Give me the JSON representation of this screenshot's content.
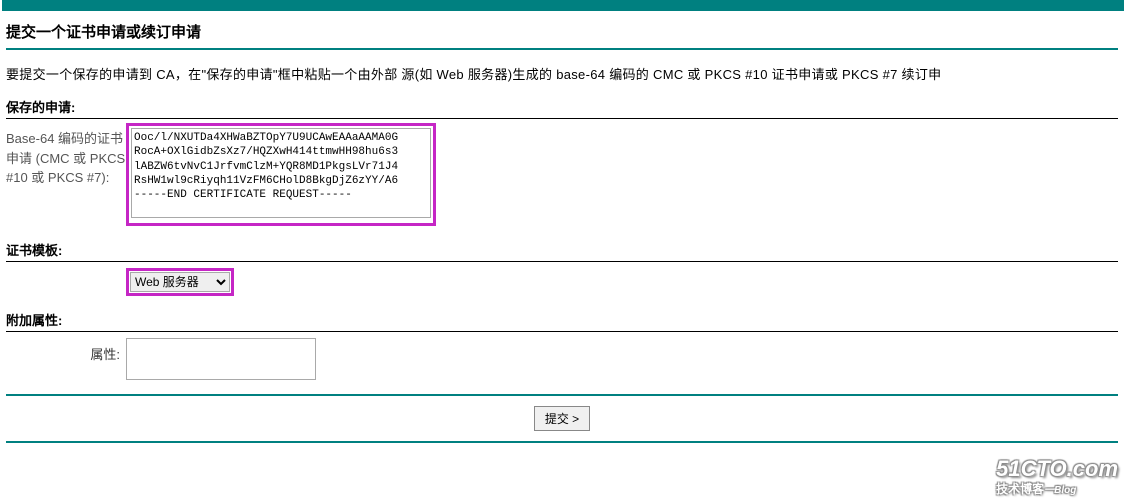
{
  "page": {
    "title": "提交一个证书申请或续订申请",
    "instructions": "要提交一个保存的申请到 CA，在\"保存的申请\"框中粘贴一个由外部 源(如 Web 服务器)生成的 base-64 编码的 CMC 或 PKCS #10 证书申请或 PKCS #7 续订申"
  },
  "saved_request": {
    "section_label": "保存的申请:",
    "field_label": "Base-64 编码的证书申请 (CMC 或 PKCS #10 或 PKCS #7):",
    "value": "Ooc/l/NXUTDa4XHWaBZTOpY7U9UCAwEAAaAAMA0G\nRocA+OXlGidbZsXz7/HQZXwH414ttmwHH98hu6s3\nlABZW6tvNvC1JrfvmClzM+YQR8MD1PkgsLVr71J4\nRsHW1wl9cRiyqh11VzFM6CHolD8BkgDjZ6zYY/A6\n-----END CERTIFICATE REQUEST-----"
  },
  "cert_template": {
    "section_label": "证书模板:",
    "selected": "Web 服务器"
  },
  "additional_attrs": {
    "section_label": "附加属性:",
    "field_label": "属性:",
    "value": ""
  },
  "submit": {
    "label": "提交 >"
  },
  "watermark": {
    "main": "51CTO.com",
    "sub": "技术博客",
    "blog": "一Blog"
  }
}
